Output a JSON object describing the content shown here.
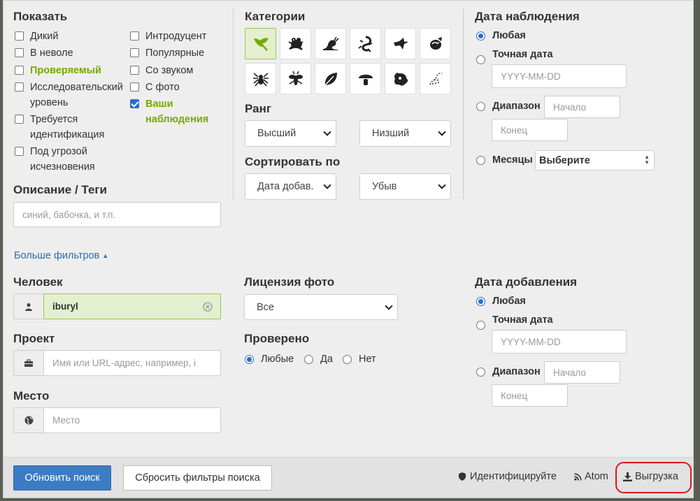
{
  "show": {
    "title": "Показать",
    "left": [
      {
        "label": "Дикий",
        "checked": false,
        "green": false
      },
      {
        "label": "В неволе",
        "checked": false,
        "green": false
      },
      {
        "label": "Проверяемый",
        "checked": false,
        "green": true
      },
      {
        "label": "Исследовательский уровень",
        "checked": false,
        "green": false
      },
      {
        "label": "Требуется идентификация",
        "checked": false,
        "green": false
      },
      {
        "label": "Под угрозой исчезновения",
        "checked": false,
        "green": false
      }
    ],
    "right": [
      {
        "label": "Интродуцент",
        "checked": false,
        "green": false
      },
      {
        "label": "Популярные",
        "checked": false,
        "green": false
      },
      {
        "label": "Со звуком",
        "checked": false,
        "green": false
      },
      {
        "label": "С фото",
        "checked": false,
        "green": false
      },
      {
        "label": "Ваши наблюдения",
        "checked": true,
        "green": true
      }
    ]
  },
  "description": {
    "title": "Описание / Теги",
    "placeholder": "синий, бабочка, и т.п."
  },
  "categories": {
    "title": "Категории",
    "icons": [
      "plant-icon",
      "amphibian-icon",
      "mollusk-icon",
      "reptile-icon",
      "bird-icon",
      "mammal-icon",
      "arachnid-icon",
      "insect-icon",
      "fungi-leaf-icon",
      "mushroom-icon",
      "protozoa-icon",
      "unknown-icon"
    ]
  },
  "rank": {
    "title": "Ранг",
    "high": "Высший",
    "low": "Низший"
  },
  "sort": {
    "title": "Сортировать по",
    "by": "Дата добав.",
    "order": "Убыв"
  },
  "obs_date": {
    "title": "Дата наблюдения",
    "any": "Любая",
    "exact": "Точная дата",
    "exact_placeholder": "YYYY-MM-DD",
    "range": "Диапазон",
    "start_placeholder": "Начало",
    "end_placeholder": "Конец",
    "months": "Месяцы",
    "months_select": "Выберите"
  },
  "more_filters": "Больше фильтров",
  "person": {
    "title": "Человек",
    "value": "iburyl"
  },
  "project": {
    "title": "Проект",
    "placeholder": "Имя или URL-адрес, например, i"
  },
  "place": {
    "title": "Место",
    "placeholder": "Место"
  },
  "license": {
    "title": "Лицензия фото",
    "value": "Все"
  },
  "verified": {
    "title": "Проверено",
    "any": "Любые",
    "yes": "Да",
    "no": "Нет"
  },
  "added_date": {
    "title": "Дата добавления",
    "any": "Любая",
    "exact": "Точная дата",
    "exact_placeholder": "YYYY-MM-DD",
    "range": "Диапазон",
    "start_placeholder": "Начало",
    "end_placeholder": "Конец"
  },
  "footer": {
    "update": "Обновить поиск",
    "reset": "Сбросить фильтры поиска",
    "identify": "Идентифицируйте",
    "atom": "Atom",
    "download": "Выгрузка"
  },
  "colors": {
    "accent_green": "#74ac00",
    "primary_blue": "#3c7cc4",
    "checkbox_blue": "#2b6bd6",
    "highlight_red": "#e0121a"
  }
}
